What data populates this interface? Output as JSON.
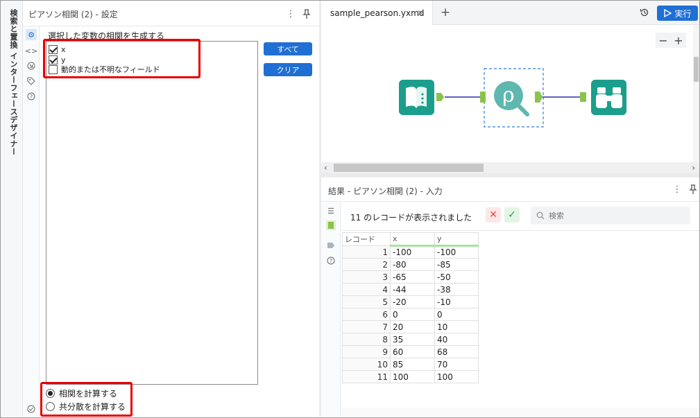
{
  "sidebar": {
    "search_label": "検索と置換",
    "designer_label": "インターフェースデザイナー"
  },
  "config": {
    "title": "ピアソン相関 (2) - 設定",
    "fields_label": "選択した変数の相関を生成する",
    "fields": [
      {
        "label": "x",
        "checked": true
      },
      {
        "label": "y",
        "checked": true
      },
      {
        "label": "動的または不明なフィールド",
        "checked": false
      }
    ],
    "all_button": "すべて",
    "clear_button": "クリア",
    "options": [
      {
        "label": "相関を計算する",
        "selected": true
      },
      {
        "label": "共分散を計算する",
        "selected": false
      }
    ]
  },
  "canvas": {
    "tab_label": "sample_pearson.yxmd",
    "run_label": "実行",
    "zoom_minus": "−",
    "zoom_plus": "+",
    "tools": [
      "input-data-tool",
      "pearson-correlation-tool",
      "browse-tool"
    ],
    "colors": {
      "tool_teal": "#1b9e8b",
      "tool_pearson": "#5fb7b0",
      "anchor": "#8bc34a",
      "connector": "#2a2fa8"
    }
  },
  "results": {
    "title": "結果 - ピアソン相関 (2) - 入力",
    "record_count": "11 のレコードが表示されました",
    "search_placeholder": "検索",
    "columns": [
      "レコード",
      "x",
      "y"
    ],
    "rows": [
      [
        "1",
        "-100",
        "-100"
      ],
      [
        "2",
        "-80",
        "-85"
      ],
      [
        "3",
        "-65",
        "-50"
      ],
      [
        "4",
        "-44",
        "-38"
      ],
      [
        "5",
        "-20",
        "-10"
      ],
      [
        "6",
        "0",
        "0"
      ],
      [
        "7",
        "20",
        "10"
      ],
      [
        "8",
        "35",
        "40"
      ],
      [
        "9",
        "60",
        "68"
      ],
      [
        "10",
        "85",
        "70"
      ],
      [
        "11",
        "100",
        "100"
      ]
    ]
  }
}
